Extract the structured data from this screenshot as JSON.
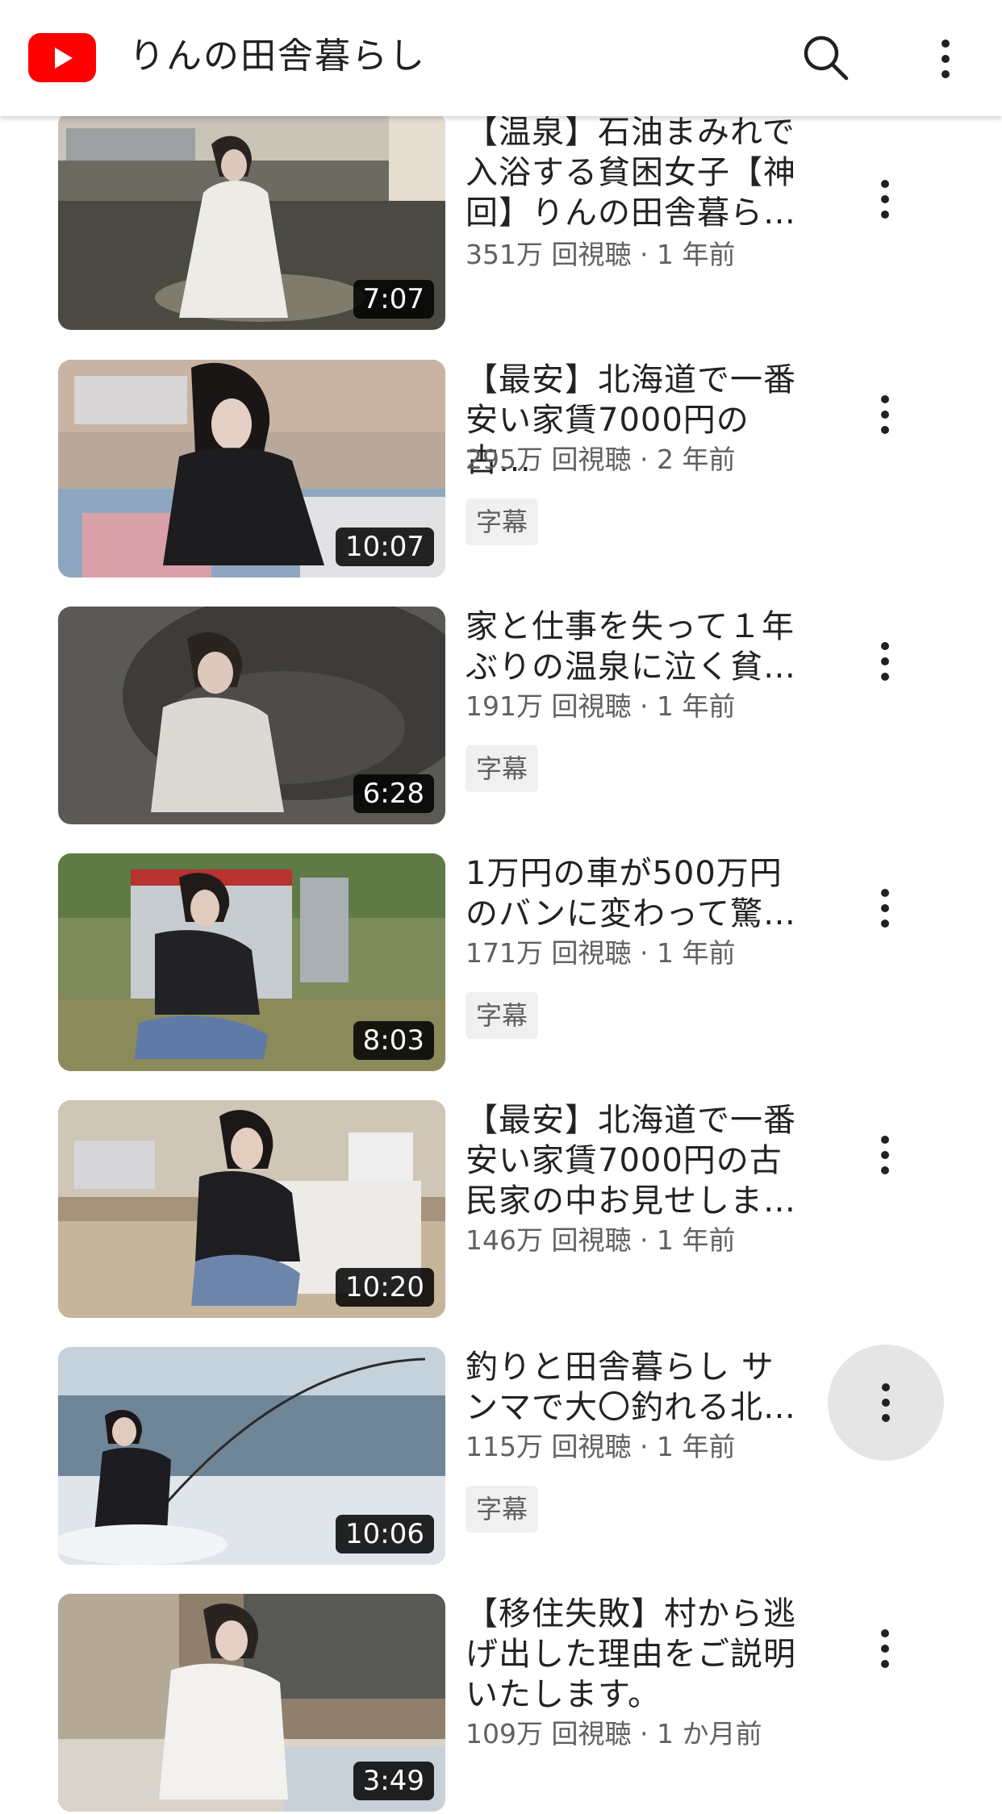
{
  "header": {
    "channel_title": "りんの田舎暮らし",
    "icons": {
      "logo": "youtube-logo",
      "search": "search-icon",
      "more": "more-vert-icon"
    },
    "brand_color": "#ff0000"
  },
  "videos": [
    {
      "title": "【温泉】石油まみれで\n入浴する貧困女子【神\n回】りんの田舎暮ら…",
      "views": "351万 回視聴",
      "age": "1 年前",
      "duration": "7:07",
      "badge": ""
    },
    {
      "title": "【最安】北海道で一番\n安い家賃7000円の古…",
      "views": "295万 回視聴",
      "age": "2 年前",
      "duration": "10:07",
      "badge": "字幕"
    },
    {
      "title": "家と仕事を失って１年\nぶりの温泉に泣く貧…",
      "views": "191万 回視聴",
      "age": "1 年前",
      "duration": "6:28",
      "badge": "字幕"
    },
    {
      "title": "1万円の車が500万円\nのバンに変わって驚…",
      "views": "171万 回視聴",
      "age": "1 年前",
      "duration": "8:03",
      "badge": "字幕"
    },
    {
      "title": "【最安】北海道で一番\n安い家賃7000円の古\n民家の中お見せしま…",
      "views": "146万 回視聴",
      "age": "1 年前",
      "duration": "10:20",
      "badge": ""
    },
    {
      "title": "釣りと田舎暮らし サ\nンマで大〇釣れる北…",
      "views": "115万 回視聴",
      "age": "1 年前",
      "duration": "10:06",
      "badge": "字幕"
    },
    {
      "title": "【移住失敗】村から逃\nげ出した理由をご説明\nいたします。",
      "views": "109万 回視聴",
      "age": "1 か月前",
      "duration": "3:49",
      "badge": ""
    }
  ]
}
